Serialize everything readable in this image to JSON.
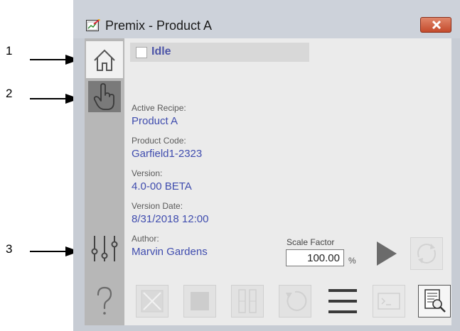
{
  "callouts": [
    "1",
    "2",
    "3"
  ],
  "window": {
    "title": "Premix - Product A",
    "close_label": "close"
  },
  "sidebar": {
    "items": [
      {
        "name": "home",
        "icon": "home-icon",
        "selected": true
      },
      {
        "name": "manual",
        "icon": "hand-pointer-icon",
        "selected": false
      },
      {
        "name": "tuning",
        "icon": "sliders-icon",
        "selected": false
      },
      {
        "name": "help",
        "icon": "question-mark-icon",
        "selected": false
      }
    ]
  },
  "state": {
    "label": "Idle"
  },
  "recipe": {
    "active_recipe_label": "Active Recipe:",
    "active_recipe_value": "Product A",
    "product_code_label": "Product Code:",
    "product_code_value": "Garfield1-2323",
    "version_label": "Version:",
    "version_value": "4.0-00 BETA",
    "version_date_label": "Version Date:",
    "version_date_value": "8/31/2018 12:00",
    "author_label": "Author:",
    "author_value": "Marvin Gardens"
  },
  "scale": {
    "label": "Scale Factor",
    "value": "100.00",
    "unit": "%"
  },
  "colors": {
    "accent_text": "#3f4cae",
    "sidebar": "#b7b7b7",
    "content_bg": "#ebebeb",
    "close_button": "#c44b2c"
  },
  "buttons": [
    {
      "name": "start-button",
      "icon": "play-icon",
      "enabled": true
    },
    {
      "name": "restart-button",
      "icon": "refresh-icon",
      "enabled": false
    },
    {
      "name": "abort-button",
      "icon": "abort-x-icon",
      "enabled": false
    },
    {
      "name": "stop-button",
      "icon": "stop-square-icon",
      "enabled": false
    },
    {
      "name": "hold-button",
      "icon": "pause-bars-icon",
      "enabled": false
    },
    {
      "name": "reset-button",
      "icon": "reset-circular-icon",
      "enabled": false
    },
    {
      "name": "menu-button",
      "icon": "hamburger-menu-icon",
      "enabled": true
    },
    {
      "name": "command-button",
      "icon": "terminal-icon",
      "enabled": false
    },
    {
      "name": "report-button",
      "icon": "report-search-icon",
      "enabled": true
    }
  ]
}
